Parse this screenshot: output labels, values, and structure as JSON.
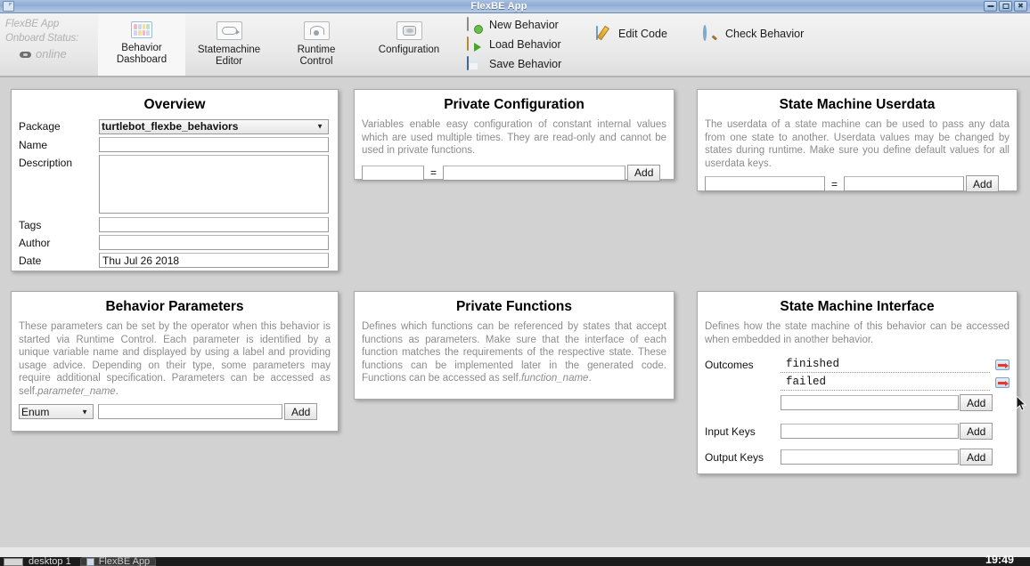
{
  "window": {
    "title": "FlexBE App",
    "icon": "document-icon",
    "buttons": {
      "minimize": "minimize-icon",
      "maximize": "maximize-icon",
      "close": "close-icon"
    }
  },
  "toolbar": {
    "status": {
      "app_name": "FlexBE  App",
      "onboard_label": "Onboard Status:",
      "connection": "online",
      "connection_icon": "plug-icon"
    },
    "tabs": [
      {
        "label_line1": "Behavior",
        "label_line2": "Dashboard",
        "icon": "dashboard-icon",
        "active": true
      },
      {
        "label_line1": "Statemachine",
        "label_line2": "Editor",
        "icon": "statemachine-icon",
        "active": false
      },
      {
        "label_line1": "Runtime",
        "label_line2": "Control",
        "icon": "runtime-icon",
        "active": false
      },
      {
        "label_line1": "Configuration",
        "label_line2": "",
        "icon": "configuration-icon",
        "active": false
      }
    ],
    "menu_col1": [
      {
        "label": "New Behavior",
        "icon": "new-document-icon"
      },
      {
        "label": "Load Behavior",
        "icon": "open-folder-icon"
      },
      {
        "label": "Save Behavior",
        "icon": "floppy-disk-icon"
      }
    ],
    "menu_col2": [
      {
        "label": "Edit Code",
        "icon": "pencil-icon"
      }
    ],
    "menu_col3": [
      {
        "label": "Check Behavior",
        "icon": "magnifier-icon"
      }
    ]
  },
  "overview": {
    "title": "Overview",
    "labels": {
      "package": "Package",
      "name": "Name",
      "description": "Description",
      "tags": "Tags",
      "author": "Author",
      "date": "Date"
    },
    "package_value": "turtlebot_flexbe_behaviors",
    "package_options": [
      "turtlebot_flexbe_behaviors"
    ],
    "name_value": "",
    "description_value": "",
    "tags_value": "",
    "author_value": "",
    "date_value": "Thu Jul 26 2018"
  },
  "private_configuration": {
    "title": "Private Configuration",
    "description": "Variables enable easy configuration of constant internal values which are used multiple times. They are read-only and cannot be used in private functions.",
    "key_value": "",
    "equals": "=",
    "value_value": "",
    "add_label": "Add"
  },
  "state_machine_userdata": {
    "title": "State Machine Userdata",
    "description": "The userdata of a state machine can be used to pass any data from one state to another. Userdata values may be changed by states during runtime. Make sure you define default values for all userdata keys.",
    "key_value": "",
    "equals": "=",
    "value_value": "",
    "add_label": "Add"
  },
  "behavior_parameters": {
    "title": "Behavior Parameters",
    "description_part1": "These parameters can be set by the operator when this behavior is started via Runtime Control. Each parameter is identified by a unique variable name and displayed by using a label and providing usage advice. Depending on their type, some parameters may require additional specification. Parameters can be accessed as self.",
    "description_italic": "parameter_name",
    "description_part2": ".",
    "type_value": "Enum",
    "type_options": [
      "Enum"
    ],
    "name_value": "",
    "add_label": "Add"
  },
  "private_functions": {
    "title": "Private Functions",
    "description_part1": "Defines which functions can be referenced by states that accept functions as parameters. Make sure that the interface of each function matches the requirements of the respective state. These functions can be implemented later in the generated code. Functions can be accessed as self.",
    "description_italic": "function_name",
    "description_part2": "."
  },
  "state_machine_interface": {
    "title": "State Machine Interface",
    "description": "Defines how the state machine of this behavior can be accessed when embedded in another behavior.",
    "outcomes_label": "Outcomes",
    "outcomes": [
      {
        "name": "finished",
        "icon": "outcome-arrow-icon"
      },
      {
        "name": "failed",
        "icon": "outcome-arrow-icon"
      }
    ],
    "outcome_new_value": "",
    "outcome_add_label": "Add",
    "input_keys_label": "Input Keys",
    "input_keys_value": "",
    "input_keys_add_label": "Add",
    "output_keys_label": "Output Keys",
    "output_keys_value": "",
    "output_keys_add_label": "Add"
  },
  "taskbar": {
    "show_desktop_icon": "show-desktop-icon",
    "desktop_label": "desktop 1",
    "task": {
      "label": "FlexBE App",
      "icon": "document-icon"
    },
    "clock": "19:49"
  },
  "colors": {
    "titlebar": "#8fabd2",
    "toolbar_bg": "#eaeaea",
    "desktop_bg": "#d2d2d2",
    "card_bg": "#ffffff",
    "blurb_text": "#8c8c8c",
    "accent_red": "#e23b2e"
  }
}
